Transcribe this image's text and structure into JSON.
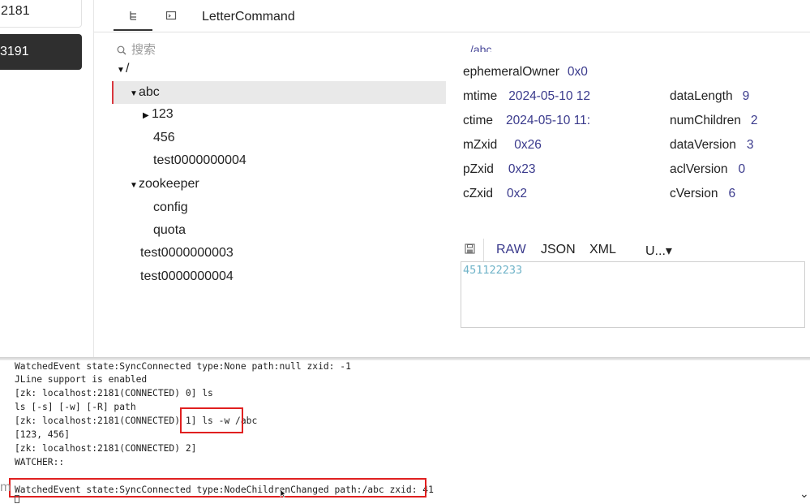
{
  "connections": [
    {
      "label": "2181"
    },
    {
      "label": "3191"
    }
  ],
  "tabs": {
    "tree_icon": "tree-icon",
    "terminal_icon": "terminal-icon",
    "letter_command": "LetterCommand"
  },
  "search": {
    "placeholder": "搜索"
  },
  "tree": {
    "root": "/",
    "abc": "abc",
    "n123": "123",
    "n456": "456",
    "test4a": "test0000000004",
    "zookeeper": "zookeeper",
    "config": "config",
    "quota": "quota",
    "test3": "test0000000003",
    "test4b": "test0000000004"
  },
  "detail": {
    "path": "/abc",
    "left_stats": [
      {
        "key": "ephemeralOwner",
        "value": "0x0"
      },
      {
        "key": "mtime",
        "value": "2024-05-10 12"
      },
      {
        "key": "ctime",
        "value": "2024-05-10 11:"
      },
      {
        "key": "mZxid",
        "value": "0x26"
      },
      {
        "key": "pZxid",
        "value": "0x23"
      },
      {
        "key": "cZxid",
        "value": "0x2"
      }
    ],
    "right_stats": [
      {
        "key": "dataLength",
        "value": "9"
      },
      {
        "key": "numChildren",
        "value": "2"
      },
      {
        "key": "dataVersion",
        "value": "3"
      },
      {
        "key": "aclVersion",
        "value": "0"
      },
      {
        "key": "cVersion",
        "value": "6"
      }
    ],
    "formats": {
      "raw": "RAW",
      "json": "JSON",
      "xml": "XML",
      "more": "U...▾"
    },
    "data_value": "451122233"
  },
  "terminal": {
    "lines": [
      "WatchedEvent state:SyncConnected type:None path:null zxid: -1",
      "JLine support is enabled",
      "[zk: localhost:2181(CONNECTED) 0] ls",
      "ls [-s] [-w] [-R] path",
      "[zk: localhost:2181(CONNECTED) 1] ls -w /abc",
      "[123, 456]",
      "[zk: localhost:2181(CONNECTED) 2]",
      "WATCHER::",
      "",
      "WatchedEvent state:SyncConnected type:NodeChildrenChanged path:/abc zxid: 41"
    ],
    "gutter": "m",
    "scroll_icon": "chevron-down-icon"
  },
  "colors": {
    "accent": "#3a3a8c",
    "selected_marker": "#d9363e",
    "highlight_box": "#e02020"
  }
}
